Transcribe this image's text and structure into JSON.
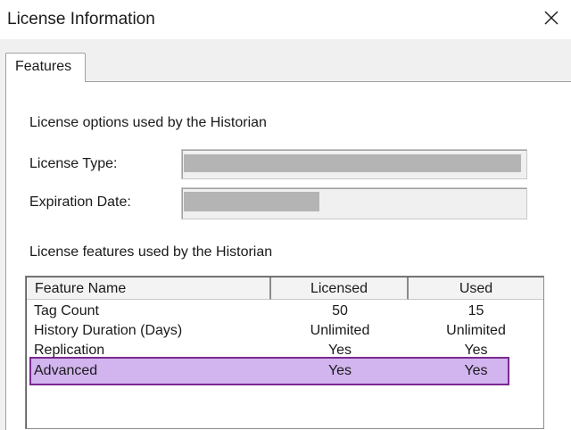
{
  "window": {
    "title": "License Information",
    "close_icon": "close-icon"
  },
  "tabs": [
    {
      "label": "Features",
      "selected": true
    }
  ],
  "options_section": {
    "heading": "License options used by the Historian",
    "license_type_label": "License Type:",
    "expiration_date_label": "Expiration Date:"
  },
  "features_section": {
    "heading": "License features used by the Historian",
    "columns": [
      "Feature Name",
      "Licensed",
      "Used"
    ],
    "rows": [
      {
        "feature": "Tag Count",
        "licensed": "50",
        "used": "15"
      },
      {
        "feature": "History Duration (Days)",
        "licensed": "Unlimited",
        "used": "Unlimited"
      },
      {
        "feature": "Replication",
        "licensed": "Yes",
        "used": "Yes"
      },
      {
        "feature": "Advanced",
        "licensed": "Yes",
        "used": "Yes",
        "highlighted": true
      }
    ]
  },
  "colors": {
    "highlight_fill": "#ba8ce6",
    "highlight_border": "#7a2a90"
  }
}
